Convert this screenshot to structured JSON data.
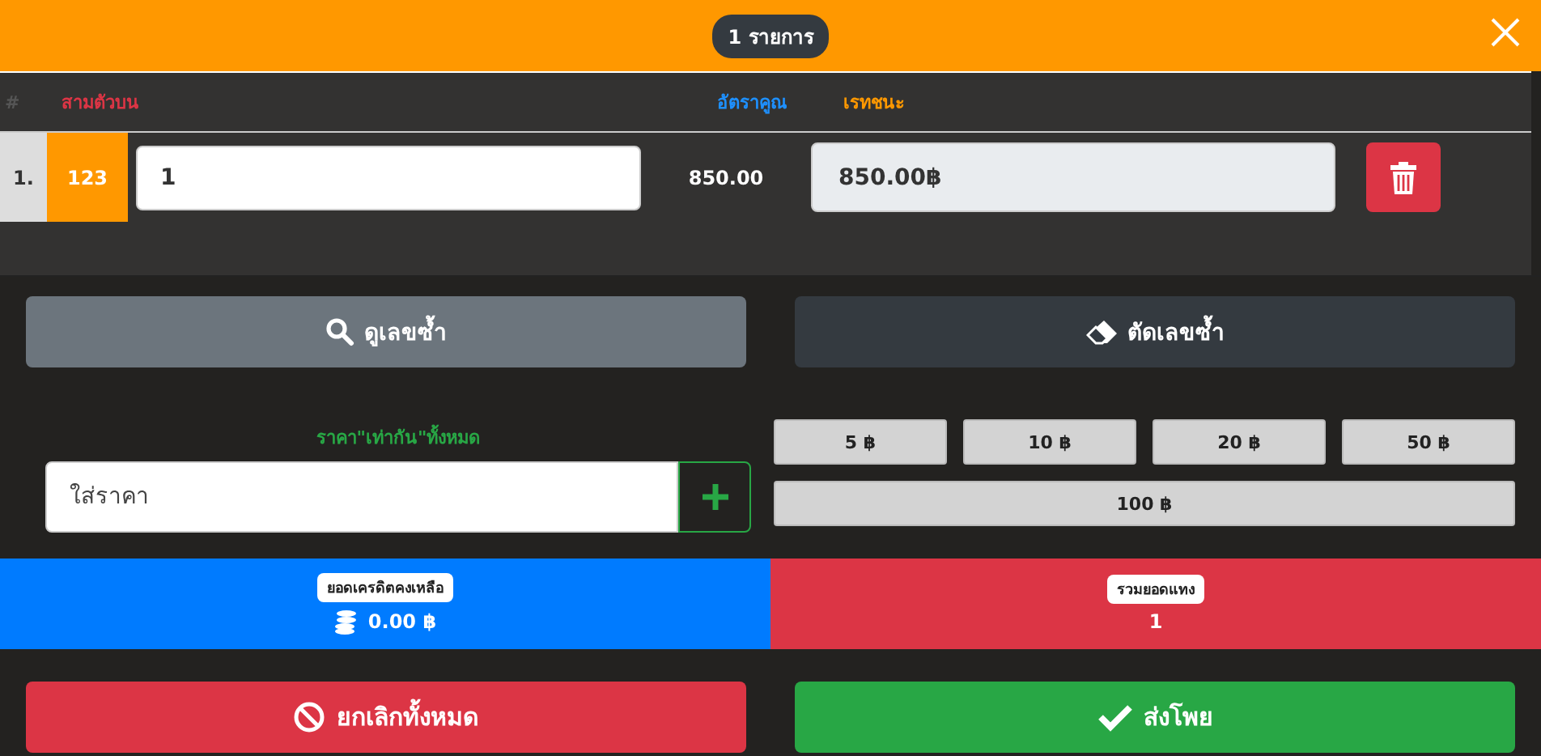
{
  "header": {
    "count_badge": "1 รายการ"
  },
  "table": {
    "columns": [
      {
        "label": "#",
        "color": "#555555"
      },
      {
        "label": "สามตัวบน",
        "color": "#dc3545"
      },
      {
        "label": "อัตราคูณ",
        "color": "#1e90ff"
      },
      {
        "label": "เรทชนะ",
        "color": "#ff9800"
      }
    ],
    "rows": [
      {
        "index": "1.",
        "number": "123",
        "amount": "1",
        "multiplier": "850.00",
        "payout": "850.00฿"
      }
    ]
  },
  "tools": [
    {
      "label": "ดูเลขซ้ำ",
      "kind": "search"
    },
    {
      "label": "ตัดเลขซ้ำ",
      "kind": "erase"
    }
  ],
  "price": {
    "label": "ราคา\"เท่ากัน\"ทั้งหมด",
    "placeholder": "ใส่ราคา"
  },
  "quick_amounts": [
    "5 ฿",
    "10 ฿",
    "20 ฿",
    "50 ฿",
    "100 ฿"
  ],
  "summary": [
    {
      "label": "ยอดเครดิตคงเหลือ",
      "value": "0.00 ฿",
      "kind": "credit"
    },
    {
      "label": "รวมยอดแทง",
      "value": "1",
      "kind": "total"
    }
  ],
  "actions": [
    {
      "label": "ยกเลิกทั้งหมด",
      "kind": "cancel"
    },
    {
      "label": "ส่งโพย",
      "kind": "submit"
    }
  ]
}
